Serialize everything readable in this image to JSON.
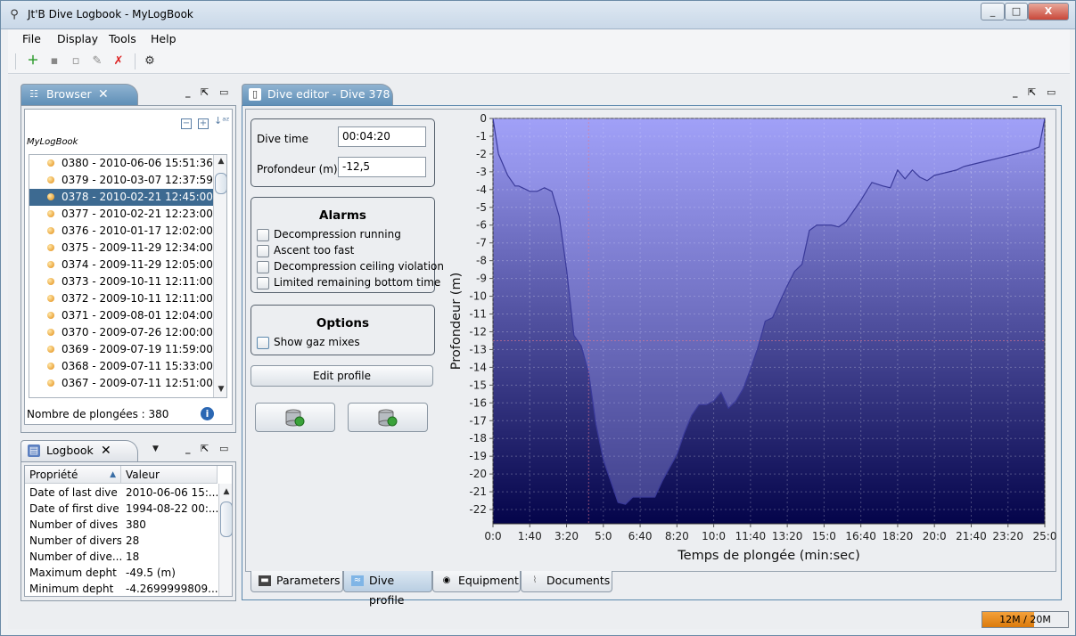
{
  "window": {
    "title": "Jt'B Dive Logbook - MyLogBook",
    "min": "_",
    "max": "□",
    "close": "X"
  },
  "menu": [
    "File",
    "Display",
    "Tools",
    "Help"
  ],
  "browser": {
    "tab_label": "Browser",
    "root_label": "MyLogBook",
    "dives": [
      "0380 - 2010-06-06 15:51:36",
      "0379 - 2010-03-07 12:37:59",
      "0378 - 2010-02-21 12:45:00",
      "0377 - 2010-02-21 12:23:00",
      "0376 - 2010-01-17 12:02:00",
      "0375 - 2009-11-29 12:34:00",
      "0374 - 2009-11-29 12:05:00",
      "0373 - 2009-10-11 12:11:00",
      "0372 - 2009-10-11 12:11:00",
      "0371 - 2009-08-01 12:04:00",
      "0370 - 2009-07-26 12:00:00",
      "0369 - 2009-07-19 11:59:00",
      "0368 - 2009-07-11 15:33:00",
      "0367 - 2009-07-11 12:51:00"
    ],
    "selected_index": 2,
    "count_label": "Nombre de plongées : 380"
  },
  "logbook": {
    "tab_label": "Logbook",
    "col_property": "Propriété",
    "col_value": "Valeur",
    "rows": [
      {
        "property": "Date of last dive",
        "value": "2010-06-06 15:..."
      },
      {
        "property": "Date of first dive",
        "value": "1994-08-22 00:..."
      },
      {
        "property": "Number of dives",
        "value": "380"
      },
      {
        "property": "Number of divers",
        "value": "28"
      },
      {
        "property": "Number of dive...",
        "value": "18"
      },
      {
        "property": "Maximum depht",
        "value": "-49.5 (m)"
      },
      {
        "property": "Minimum depht",
        "value": "-4.2699999809..."
      }
    ]
  },
  "editor": {
    "tab_label": "Dive editor - Dive 378",
    "dive_time_label": "Dive time",
    "dive_time_value": "00:04:20",
    "depth_label": "Profondeur (m)",
    "depth_value": "-12,5",
    "alarms_title": "Alarms",
    "alarms": [
      "Decompression running",
      "Ascent too fast",
      "Decompression ceiling violation",
      "Limited remaining bottom time"
    ],
    "options_title": "Options",
    "options": [
      "Show gaz mixes"
    ],
    "edit_profile_label": "Edit profile",
    "bottom_tabs": [
      {
        "label": "Parameters",
        "icon": "panel-icon"
      },
      {
        "label": "Dive profile",
        "icon": "profile-icon"
      },
      {
        "label": "Equipment",
        "icon": "mask-icon"
      },
      {
        "label": "Documents",
        "icon": "paperclip-icon"
      }
    ],
    "active_bottom_tab": 1
  },
  "memory": {
    "label": "12M / 20M",
    "used": 12,
    "total": 20
  },
  "colors": {
    "selection": "#3d6a91",
    "tab_active": "#6d97bc",
    "chart_top": "#9c9cf4",
    "chart_bottom": "#04044a",
    "memory_fill": "#e88a1a"
  },
  "chart_data": {
    "type": "area",
    "xlabel": "Temps de plongée (min:sec)",
    "ylabel": "Profondeur (m)",
    "x_ticks": [
      "0:0",
      "1:40",
      "3:20",
      "5:0",
      "6:40",
      "8:20",
      "10:0",
      "11:40",
      "13:20",
      "15:0",
      "16:40",
      "18:20",
      "20:0",
      "21:40",
      "23:20",
      "25:0"
    ],
    "xlim_sec": [
      0,
      1500
    ],
    "ylim": [
      -22.8,
      0
    ],
    "y_ticks": [
      0,
      -1,
      -2,
      -3,
      -4,
      -5,
      -6,
      -7,
      -8,
      -9,
      -10,
      -11,
      -12,
      -13,
      -14,
      -15,
      -16,
      -17,
      -18,
      -19,
      -20,
      -21,
      -22
    ],
    "cursor_time_sec": 260,
    "cursor_depth": -12.5,
    "series": [
      {
        "time_sec": [
          0,
          15,
          40,
          60,
          70,
          80,
          100,
          120,
          140,
          160,
          180,
          200,
          220,
          240,
          260,
          280,
          300,
          320,
          340,
          360,
          380,
          400,
          420,
          440,
          460,
          500,
          520,
          540,
          560,
          580,
          600,
          620,
          640,
          660,
          680,
          700,
          720,
          740,
          760,
          780,
          800,
          820,
          840,
          860,
          880,
          900,
          920,
          940,
          960,
          980,
          1000,
          1030,
          1060,
          1080,
          1100,
          1120,
          1140,
          1160,
          1180,
          1200,
          1220,
          1240,
          1260,
          1280,
          1300,
          1320,
          1340,
          1360,
          1380,
          1400,
          1420,
          1440,
          1460,
          1485,
          1500
        ],
        "depth": [
          0,
          -2,
          -3.2,
          -3.8,
          -3.8,
          -3.9,
          -4.1,
          -4.1,
          -3.9,
          -4.1,
          -5.5,
          -8.5,
          -12.2,
          -12.8,
          -14.3,
          -17.2,
          -19.2,
          -20.4,
          -21.6,
          -21.7,
          -21.3,
          -21.3,
          -21.3,
          -21.3,
          -20.4,
          -18.9,
          -17.7,
          -16.7,
          -16.1,
          -16.1,
          -15.9,
          -15.4,
          -16.3,
          -15.9,
          -15.2,
          -14.1,
          -12.9,
          -11.4,
          -11.2,
          -10.3,
          -9.4,
          -8.6,
          -8.2,
          -6.3,
          -6.0,
          -6.0,
          -6.0,
          -6.1,
          -5.8,
          -5.2,
          -4.6,
          -3.6,
          -3.8,
          -3.9,
          -2.9,
          -3.4,
          -2.9,
          -3.3,
          -3.5,
          -3.2,
          -3.1,
          -3.0,
          -2.9,
          -2.7,
          -2.6,
          -2.5,
          -2.4,
          -2.3,
          -2.2,
          -2.1,
          -2.0,
          -1.9,
          -1.8,
          -1.6,
          0
        ]
      }
    ]
  }
}
